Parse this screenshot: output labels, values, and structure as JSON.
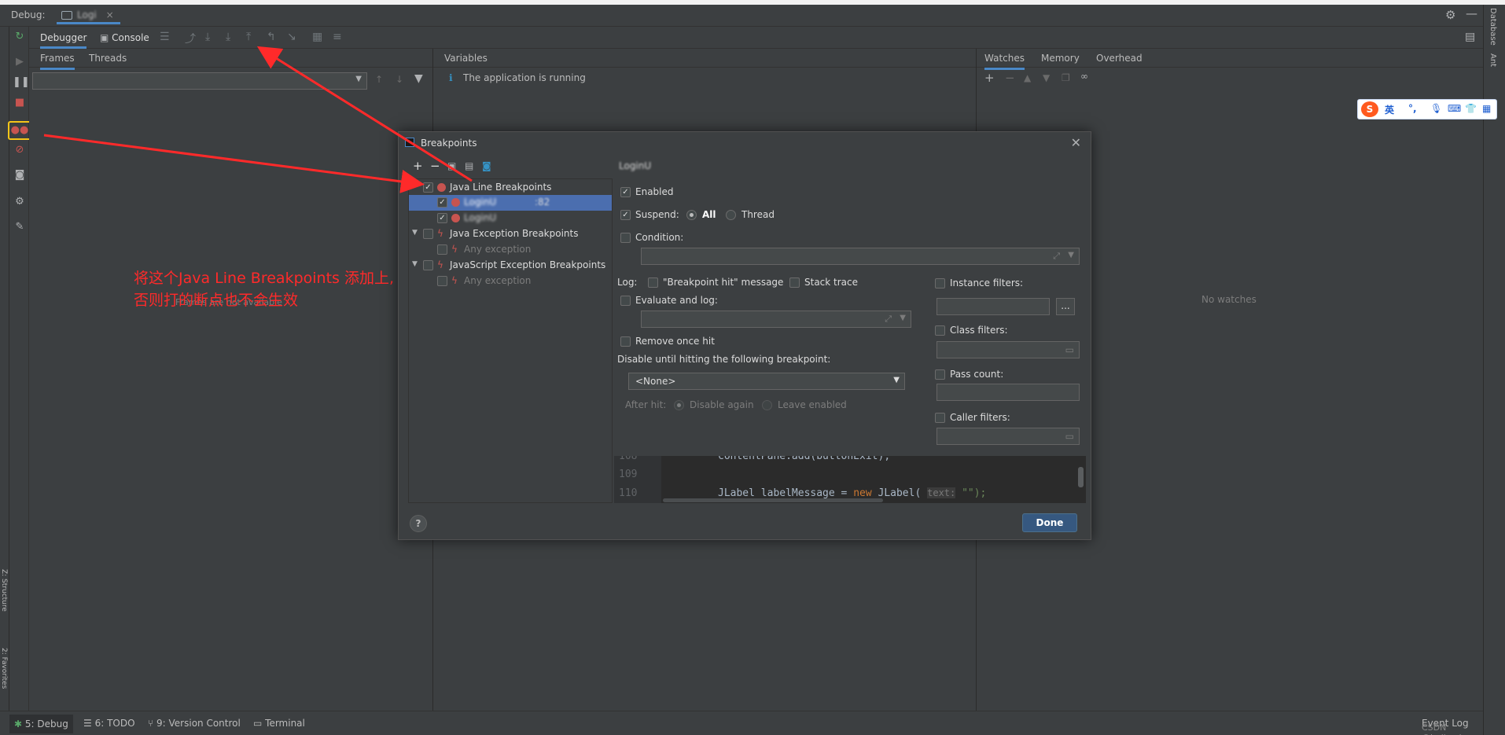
{
  "debug": {
    "label": "Debug:",
    "run_tab": "Logi",
    "close_glyph": "×"
  },
  "tabs": {
    "debugger": "Debugger",
    "console": "Console"
  },
  "frames_panel": {
    "tab_frames": "Frames",
    "tab_threads": "Threads",
    "empty": "Frames are not available"
  },
  "variables_panel": {
    "header": "Variables",
    "message": "The application is running"
  },
  "watches_panel": {
    "tab_watches": "Watches",
    "tab_memory": "Memory",
    "tab_overhead": "Overhead",
    "empty": "No watches"
  },
  "right_strip": {
    "database": "Database",
    "ant": "Ant"
  },
  "left_strip": {
    "structure": "Z: Structure",
    "favorites": "2: Favorites"
  },
  "bottom": {
    "debug": "5: Debug",
    "todo": "6: TODO",
    "vcs": "9: Version Control",
    "terminal": "Terminal",
    "event_log": "Event Log",
    "watermark": "CSDN @heiback"
  },
  "annotation": {
    "line1": "将这个Java Line Breakpoints 添加上,",
    "line2": "否则打的断点也不会生效"
  },
  "ime": {
    "logo": "S",
    "lang": "英",
    "punct": "°,"
  },
  "dialog": {
    "title": "Breakpoints",
    "detail_title": "LoginU",
    "tree": {
      "java_line": "Java Line Breakpoints",
      "item1": "LoginU",
      "item1_suffix": ":82",
      "item2": "LoginU",
      "java_exception": "Java Exception Breakpoints",
      "any1": "Any exception",
      "js_exception": "JavaScript Exception Breakpoints",
      "any2": "Any exception"
    },
    "enabled": "Enabled",
    "suspend": "Suspend:",
    "all": "All",
    "thread": "Thread",
    "condition": "Condition:",
    "log": "Log:",
    "hit_message": "\"Breakpoint hit\" message",
    "stack_trace": "Stack trace",
    "evaluate_log": "Evaluate and log:",
    "remove_once": "Remove once hit",
    "disable_until": "Disable until hitting the following breakpoint:",
    "none_option": "<None>",
    "after_hit": "After hit:",
    "disable_again": "Disable again",
    "leave_enabled": "Leave enabled",
    "instance_filters": "Instance filters:",
    "class_filters": "Class filters:",
    "pass_count": "Pass count:",
    "caller_filters": "Caller filters:",
    "ellipsis": "...",
    "done": "Done",
    "help": "?",
    "code": [
      {
        "num": "108",
        "text": "contentPane.add(buttonExit);"
      },
      {
        "num": "109",
        "text": ""
      },
      {
        "num": "110",
        "text_a": "JLabel labelMessage = ",
        "kw": "new",
        "text_b": " JLabel( ",
        "hint": "text:",
        "text_c": " \"\");"
      }
    ]
  },
  "colors": {
    "accent": "#4a88c7",
    "selection": "#4b6eaf",
    "annotation": "#ff2a2a",
    "breakpoint": "#c75450"
  }
}
